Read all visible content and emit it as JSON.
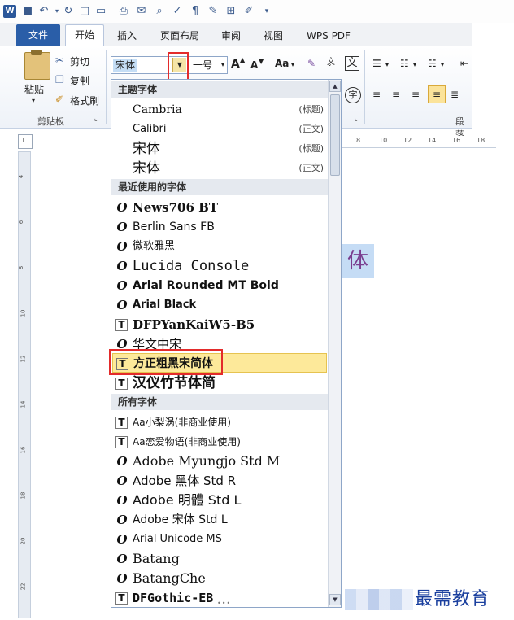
{
  "window": {
    "app_icon_letter": "W"
  },
  "quick_access": [
    "save-icon",
    "undo-icon",
    "redo-icon",
    "open-icon",
    "print-icon",
    "preview-icon",
    "spell-icon",
    "format-icon",
    "draw-icon",
    "org-icon",
    "customize-icon"
  ],
  "tabs": [
    {
      "label": "文件",
      "active": false
    },
    {
      "label": "开始",
      "active": true
    },
    {
      "label": "插入",
      "active": false
    },
    {
      "label": "页面布局",
      "active": false
    },
    {
      "label": "审阅",
      "active": false
    },
    {
      "label": "视图",
      "active": false
    },
    {
      "label": "WPS PDF",
      "active": false
    }
  ],
  "clipboard": {
    "paste": "粘贴",
    "cut": "剪切",
    "copy": "复制",
    "format_painter": "格式刷",
    "group_label": "剪贴板"
  },
  "font_combo": {
    "value": "宋体",
    "size_value": "一号"
  },
  "ribbon_extra": {
    "grow_label": "A",
    "shrink_label": "A",
    "case_label": "Aa",
    "wen_label": "文",
    "zi_label": "字",
    "paragraph_label": "段落"
  },
  "dropdown": {
    "theme_header": "主题字体",
    "theme_fonts": [
      {
        "name": "Cambria",
        "tag": "(标题)"
      },
      {
        "name": "Calibri",
        "tag": "(正文)"
      },
      {
        "name": "宋体",
        "tag": "(标题)"
      },
      {
        "name": "宋体",
        "tag": "(正文)"
      }
    ],
    "recent_header": "最近使用的字体",
    "recent_fonts": [
      {
        "name": "News706 BT",
        "kind": "O"
      },
      {
        "name": "Berlin Sans FB",
        "kind": "O"
      },
      {
        "name": "微软雅黑",
        "kind": "O"
      },
      {
        "name": "Lucida Console",
        "kind": "O"
      },
      {
        "name": "Arial Rounded MT Bold",
        "kind": "O"
      },
      {
        "name": "Arial Black",
        "kind": "O"
      },
      {
        "name": "DFPYanKaiW5-B5",
        "kind": "T"
      },
      {
        "name": "华文中宋",
        "kind": "O"
      },
      {
        "name": "方正粗黑宋简体",
        "kind": "T",
        "selected": true
      },
      {
        "name": "汉仪竹节体简",
        "kind": "T"
      }
    ],
    "all_header": "所有字体",
    "all_fonts": [
      {
        "name": "Aa小梨涡(非商业使用)",
        "kind": "T"
      },
      {
        "name": "Aa恋爱物语(非商业使用)",
        "kind": "T"
      },
      {
        "name": "Adobe Myungjo Std M",
        "kind": "O"
      },
      {
        "name": "Adobe 黑体 Std R",
        "kind": "O"
      },
      {
        "name": "Adobe 明體 Std L",
        "kind": "O"
      },
      {
        "name": "Adobe 宋体 Std L",
        "kind": "O"
      },
      {
        "name": "Arial Unicode MS",
        "kind": "O"
      },
      {
        "name": "Batang",
        "kind": "O"
      },
      {
        "name": "BatangChe",
        "kind": "O"
      },
      {
        "name": "DFGothic-EB",
        "kind": "T"
      }
    ]
  },
  "ruler": {
    "h_numbers": [
      "8",
      "10",
      "12",
      "14",
      "16",
      "18"
    ],
    "v_numbers": [
      "4",
      "6",
      "8",
      "10",
      "12",
      "14",
      "16",
      "18",
      "20",
      "22"
    ]
  },
  "document": {
    "visible_text": "体"
  },
  "watermark": {
    "text": "最需教育"
  },
  "colors": {
    "file_tab": "#2a5ea8",
    "highlight": "#fde99a",
    "red_annotation": "#e32b2b",
    "doc_text": "#7a3d8f"
  }
}
